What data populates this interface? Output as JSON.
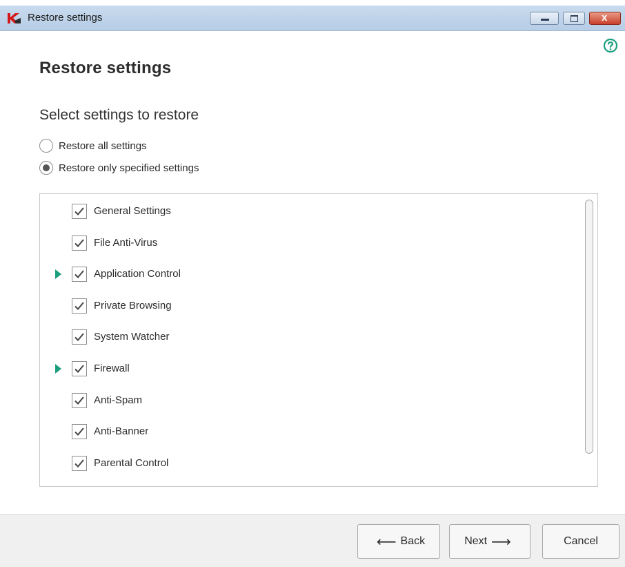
{
  "window": {
    "title": "Restore settings",
    "close_glyph": "x"
  },
  "page": {
    "title": "Restore settings",
    "section_title": "Select settings to restore"
  },
  "restore_options": [
    {
      "label": "Restore all settings",
      "selected": false
    },
    {
      "label": "Restore only specified settings",
      "selected": true
    }
  ],
  "settings_list": [
    {
      "label": "General Settings",
      "checked": true,
      "expandable": false
    },
    {
      "label": "File Anti-Virus",
      "checked": true,
      "expandable": false
    },
    {
      "label": "Application Control",
      "checked": true,
      "expandable": true
    },
    {
      "label": "Private Browsing",
      "checked": true,
      "expandable": false
    },
    {
      "label": "System Watcher",
      "checked": true,
      "expandable": false
    },
    {
      "label": "Firewall",
      "checked": true,
      "expandable": true
    },
    {
      "label": "Anti-Spam",
      "checked": true,
      "expandable": false
    },
    {
      "label": "Anti-Banner",
      "checked": true,
      "expandable": false
    },
    {
      "label": "Parental Control",
      "checked": true,
      "expandable": false
    }
  ],
  "footer": {
    "back_label": "Back",
    "back_icon": "arrow-left-icon",
    "next_label": "Next",
    "next_icon": "arrow-right-icon",
    "cancel_label": "Cancel"
  },
  "colors": {
    "accent_green": "#1a9e7e",
    "logo_red": "#d21a1a",
    "close_red": "#c8412b"
  }
}
